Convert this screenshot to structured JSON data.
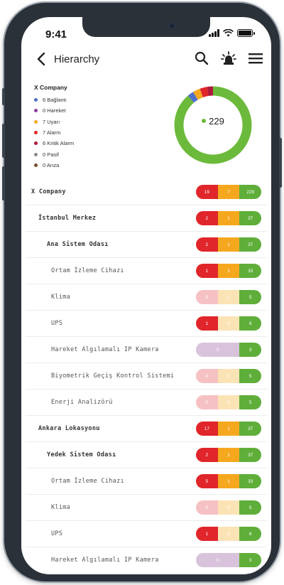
{
  "status_bar": {
    "time": "9:41"
  },
  "nav": {
    "title": "Hierarchy"
  },
  "summary": {
    "title": "X Company",
    "total": "229",
    "legend": [
      {
        "label": "6 Bağlantı",
        "color": "#4f6fc9",
        "count": 6
      },
      {
        "label": "0 Hareket",
        "color": "#8a3fa3",
        "count": 0
      },
      {
        "label": "7 Uyarı",
        "color": "#f5a81e",
        "count": 7
      },
      {
        "label": "7 Alarm",
        "color": "#e0262a",
        "count": 7
      },
      {
        "label": "6 Kritik Alarm",
        "color": "#b01a3a",
        "count": 6
      },
      {
        "label": "0 Pasif",
        "color": "#8a8a8a",
        "count": 0
      },
      {
        "label": "0 Arıza",
        "color": "#7a4a32",
        "count": 0
      }
    ],
    "ok_color": "#6cba3c"
  },
  "tree": [
    {
      "label": "X Company",
      "level": 0,
      "kind": "rag",
      "red": "19",
      "amber": "7",
      "green": "229"
    },
    {
      "label": "İstanbul Merkez",
      "level": 1,
      "kind": "rag",
      "red": "2",
      "amber": "1",
      "green": "37"
    },
    {
      "label": "Ana Sistem Odası",
      "level": 2,
      "kind": "rag",
      "red": "2",
      "amber": "1",
      "green": "37"
    },
    {
      "label": "Ortam İzleme Cihazı",
      "level": 3,
      "kind": "rag",
      "red": "1",
      "amber": "1",
      "green": "33"
    },
    {
      "label": "Klima",
      "level": 3,
      "kind": "rag-dim",
      "red": "0",
      "amber": "0",
      "green": "5"
    },
    {
      "label": "UPS",
      "level": 3,
      "kind": "rag-red",
      "red": "1",
      "amber": "0",
      "green": "6"
    },
    {
      "label": "Hareket Algılamalı IP Kamera",
      "level": 3,
      "kind": "purple",
      "red": "0",
      "amber": "",
      "green": "3"
    },
    {
      "label": "Biyometrik Geçiş Kontrol Sistemi",
      "level": 3,
      "kind": "rag-dim",
      "red": "0",
      "amber": "0",
      "green": "5"
    },
    {
      "label": "Enerji Analizörü",
      "level": 3,
      "kind": "rag-dim",
      "red": "0",
      "amber": "0",
      "green": "5"
    },
    {
      "label": "Ankara Lokasyonu",
      "level": 1,
      "kind": "rag",
      "red": "17",
      "amber": "1",
      "green": "37"
    },
    {
      "label": "Yedek Sistem Odası",
      "level": 2,
      "kind": "rag",
      "red": "2",
      "amber": "1",
      "green": "37"
    },
    {
      "label": "Ortam İzleme Cihazı",
      "level": 3,
      "kind": "rag",
      "red": "5",
      "amber": "1",
      "green": "33"
    },
    {
      "label": "Klima",
      "level": 3,
      "kind": "rag-dim",
      "red": "0",
      "amber": "0",
      "green": "5"
    },
    {
      "label": "UPS",
      "level": 3,
      "kind": "rag-red",
      "red": "1",
      "amber": "0",
      "green": "6"
    },
    {
      "label": "Hareket Algılamalı IP Kamera",
      "level": 3,
      "kind": "purple",
      "red": "0",
      "amber": "",
      "green": "3"
    }
  ],
  "icons": {
    "back": "chevron-left-icon",
    "search": "search-icon",
    "alarm": "alarm-light-icon",
    "menu": "hamburger-menu-icon"
  }
}
